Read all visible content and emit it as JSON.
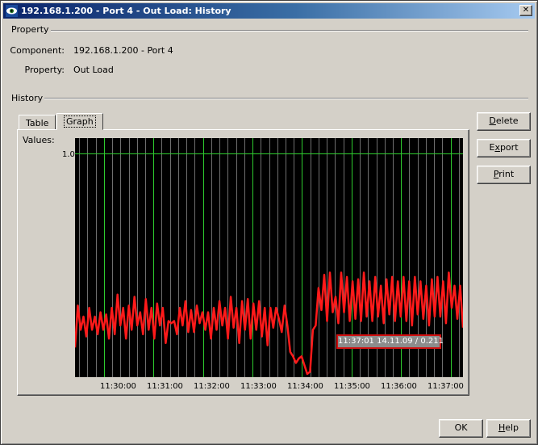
{
  "window": {
    "title": "192.168.1.200 - Port 4 - Out Load: History",
    "close_glyph": "✕"
  },
  "property_section": {
    "title": "Property",
    "component_label": "Component:",
    "component_value": "192.168.1.200 - Port 4",
    "property_label": "Property:",
    "property_value": "Out Load"
  },
  "history_section": {
    "title": "History",
    "tabs": [
      {
        "label": "Table",
        "active": false
      },
      {
        "label": "Graph",
        "active": true
      }
    ]
  },
  "chart_data": {
    "type": "line",
    "ylabel": "Values:",
    "y_ticks": [
      "1.0"
    ],
    "ylim": [
      0,
      1.07
    ],
    "x_ticks": [
      "11:30:00",
      "11:31:00",
      "11:32:00",
      "11:33:00",
      "11:34:00",
      "11:35:00",
      "11:36:00",
      "11:37:00"
    ],
    "xlim": [
      "11:29:25",
      "11:37:15"
    ],
    "grid": true,
    "background_color": "#000000",
    "grid_major_color": "#2ecc2e",
    "grid_minor_color": "#6f6f6f",
    "line_color": "#ff1a1a",
    "series": [
      {
        "values": [
          0.12,
          0.31,
          0.2,
          0.26,
          0.17,
          0.3,
          0.2,
          0.26,
          0.18,
          0.28,
          0.2,
          0.27,
          0.16,
          0.3,
          0.18,
          0.36,
          0.22,
          0.3,
          0.16,
          0.31,
          0.2,
          0.35,
          0.22,
          0.28,
          0.18,
          0.34,
          0.2,
          0.3,
          0.16,
          0.32,
          0.22,
          0.3,
          0.14,
          0.24,
          0.23,
          0.24,
          0.18,
          0.3,
          0.22,
          0.33,
          0.19,
          0.29,
          0.19,
          0.31,
          0.23,
          0.28,
          0.2,
          0.28,
          0.16,
          0.3,
          0.2,
          0.33,
          0.22,
          0.3,
          0.16,
          0.35,
          0.21,
          0.3,
          0.14,
          0.33,
          0.2,
          0.34,
          0.16,
          0.32,
          0.2,
          0.33,
          0.17,
          0.3,
          0.13,
          0.3,
          0.21,
          0.3,
          0.25,
          0.19,
          0.31,
          0.22,
          0.1,
          0.08,
          0.05,
          0.07,
          0.08,
          0.04,
          0.0,
          0.01,
          0.2,
          0.22,
          0.39,
          0.29,
          0.45,
          0.24,
          0.46,
          0.28,
          0.35,
          0.23,
          0.46,
          0.28,
          0.44,
          0.24,
          0.42,
          0.25,
          0.43,
          0.24,
          0.46,
          0.26,
          0.42,
          0.24,
          0.44,
          0.26,
          0.4,
          0.23,
          0.43,
          0.27,
          0.44,
          0.24,
          0.42,
          0.26,
          0.44,
          0.24,
          0.42,
          0.22,
          0.44,
          0.27,
          0.42,
          0.25,
          0.4,
          0.22,
          0.43,
          0.26,
          0.44,
          0.26,
          0.42,
          0.23,
          0.46,
          0.3,
          0.4,
          0.25,
          0.4,
          0.21
        ]
      }
    ],
    "tooltip": "11:37:01 14.11.09 / 0.211"
  },
  "buttons": {
    "delete": {
      "pre": "",
      "mnemonic": "D",
      "post": "elete"
    },
    "export": {
      "pre": "E",
      "mnemonic": "x",
      "post": "port"
    },
    "print": {
      "pre": "",
      "mnemonic": "P",
      "post": "rint"
    },
    "ok": "OK",
    "help": {
      "pre": "",
      "mnemonic": "H",
      "post": "elp"
    }
  }
}
